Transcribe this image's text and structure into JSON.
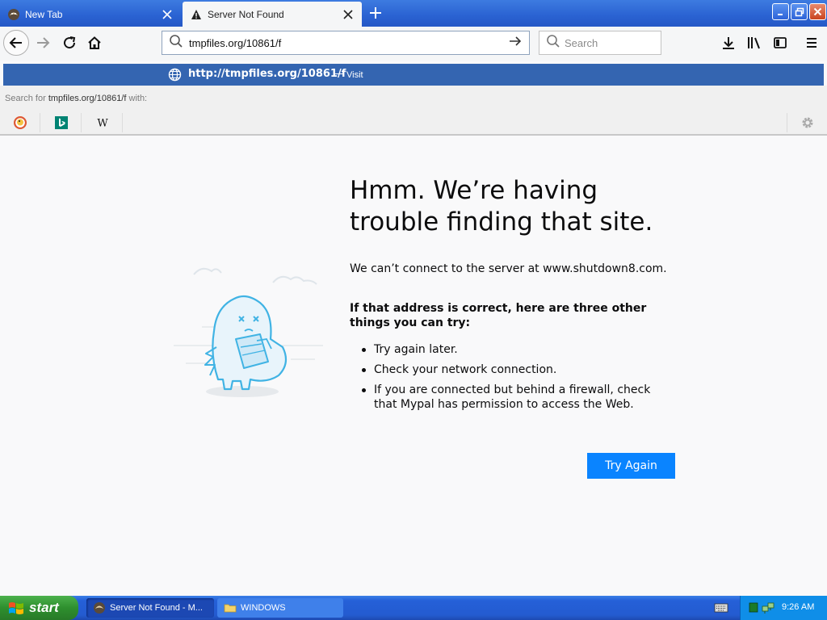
{
  "tabs": [
    {
      "label": "New Tab",
      "icon": "mypal-icon",
      "active": false
    },
    {
      "label": "Server Not Found",
      "icon": "warning-icon",
      "active": true
    }
  ],
  "toolbar": {
    "url": "tmpfiles.org/10861/f",
    "search_placeholder": "Search"
  },
  "dropdown": {
    "suggestion_url": "http://tmpfiles.org/10861/f",
    "suggestion_separator": "—",
    "suggestion_action": "Visit",
    "search_with_prefix": "Search for",
    "search_with_query": "tmpfiles.org/10861/f",
    "search_with_suffix": "with:",
    "engines": [
      "duckduckgo-icon",
      "bing-icon",
      "wikipedia-icon"
    ]
  },
  "error_page": {
    "title": "Hmm. We’re having trouble finding that site.",
    "description": "We can’t connect to the server at www.shutdown8.com.",
    "hint": "If that address is correct, here are three other things you can try:",
    "suggestions": [
      "Try again later.",
      "Check your network connection.",
      "If you are connected but behind a firewall, check that Mypal has permission to access the Web."
    ],
    "button_label": "Try Again"
  },
  "taskbar": {
    "start_label": "start",
    "tasks": [
      {
        "label": "Server Not Found - M...",
        "icon": "mypal-icon",
        "active": true
      },
      {
        "label": "WINDOWS",
        "icon": "folder-icon",
        "active": false
      }
    ],
    "clock": "9:26 AM"
  },
  "colors": {
    "accent": "#0a84ff",
    "suggestion_highlight": "#3465b1",
    "xp_blue": "#245bd0",
    "xp_green": "#2e8f2e"
  }
}
